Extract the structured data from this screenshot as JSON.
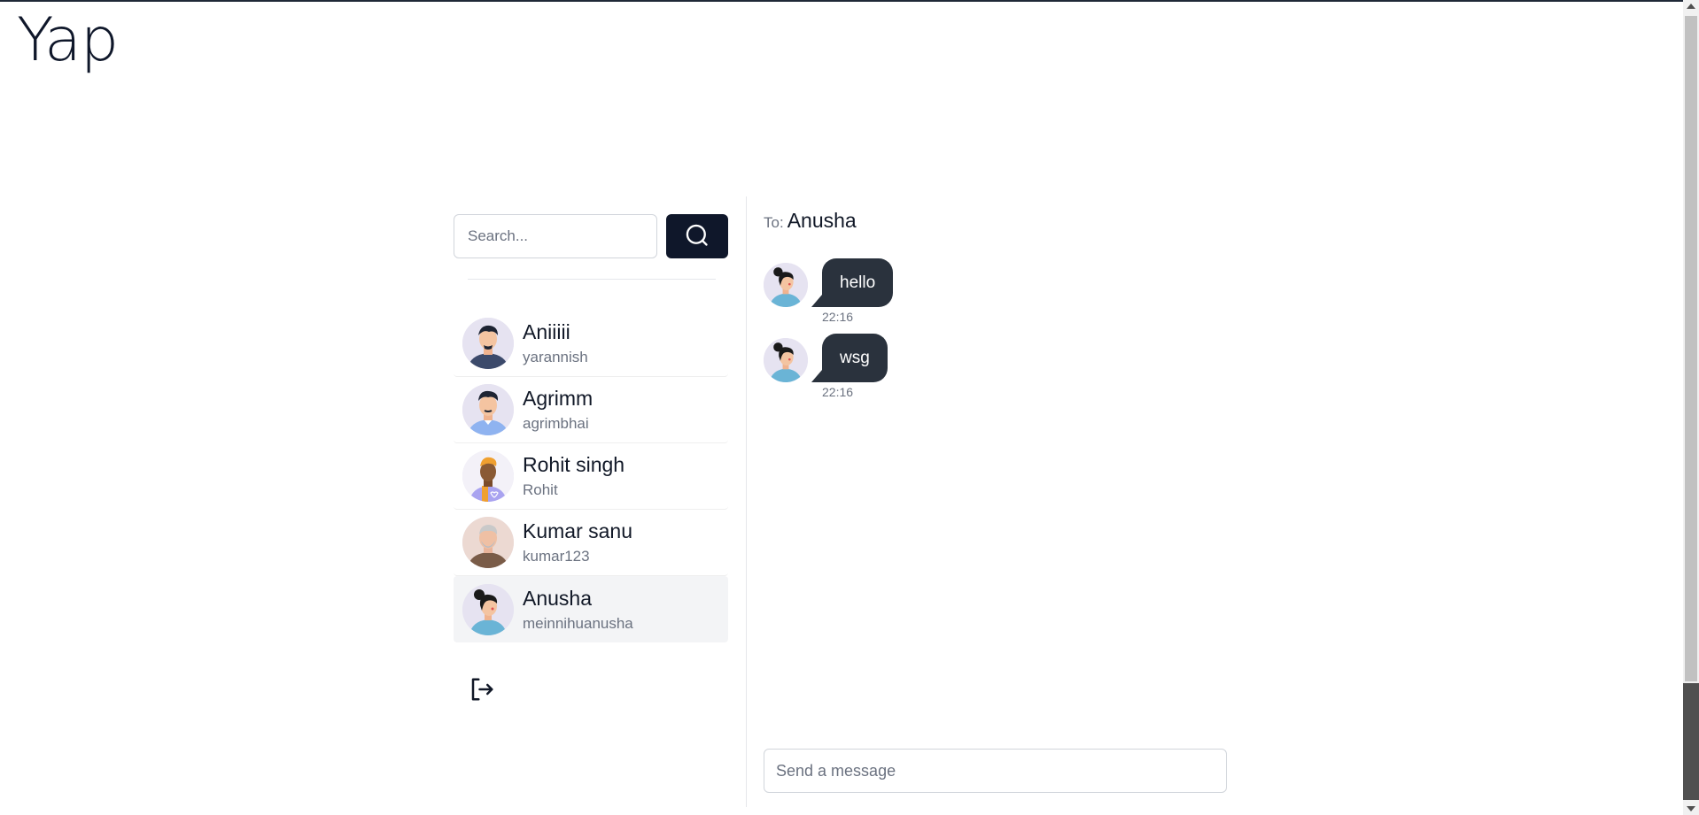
{
  "app": {
    "title": "Yap"
  },
  "search": {
    "placeholder": "Search..."
  },
  "users": [
    {
      "name": "Aniiiii",
      "handle": "yarannish",
      "avatar": "man-dark-hair-avatar"
    },
    {
      "name": "Agrimm",
      "handle": "agrimbhai",
      "avatar": "man-blue-shirt-avatar"
    },
    {
      "name": "Rohit singh",
      "handle": "Rohit",
      "avatar": "person-orange-hair-avatar"
    },
    {
      "name": "Kumar sanu",
      "handle": "kumar123",
      "avatar": "older-man-grey-beard-avatar"
    },
    {
      "name": "Anusha",
      "handle": "meinnihuanusha",
      "avatar": "woman-bun-avatar"
    }
  ],
  "selected_user_index": 4,
  "chat": {
    "to_label": "To:",
    "to_name": "Anusha",
    "messages": [
      {
        "text": "hello",
        "time": "22:16"
      },
      {
        "text": "wsg",
        "time": "22:16"
      }
    ],
    "input_placeholder": "Send a message"
  },
  "icons": {
    "search": "search-icon",
    "logout": "logout-icon"
  },
  "colors": {
    "primary": "#0f172a",
    "bubble": "#2a323d",
    "active_row": "#f3f4f6",
    "muted_text": "#6b7280"
  }
}
